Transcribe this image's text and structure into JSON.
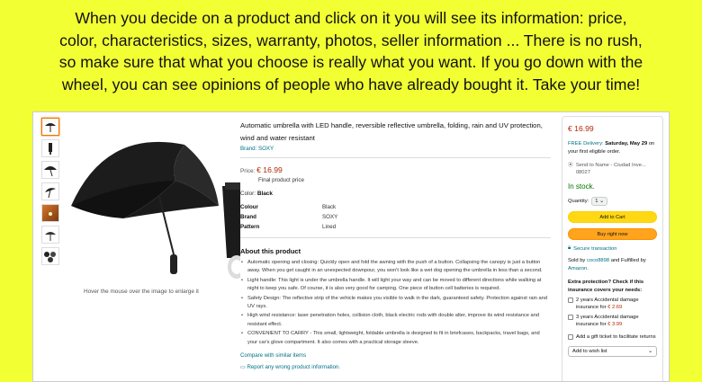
{
  "banner": {
    "lines": [
      "When you decide on a product and click on it you will see its information: price,",
      "color, characteristics, sizes, warranty, photos, seller information ... There is no rush,",
      "so make sure that what you choose is really what you want. If you go down with the",
      "wheel, you can see opinions of people who have already bought it. Take your time!"
    ]
  },
  "gallery": {
    "hover_hint": "Hover the mouse over the image to enlarge it"
  },
  "product": {
    "title": "Automatic umbrella with LED handle, reversible reflective umbrella, folding, rain and UV protection, wind and water resistant",
    "brand_link": "Brand: SOXY",
    "price_label": "Price:",
    "price_value": "€ 16.99",
    "final_price": "Final product price",
    "color_label": "Color:",
    "color_value": "Black",
    "specs": [
      {
        "k": "Colour",
        "v": "Black"
      },
      {
        "k": "Brand",
        "v": "SOXY"
      },
      {
        "k": "Pattern",
        "v": "Lined"
      }
    ],
    "about_heading": "About this product",
    "bullets": [
      "Automatic opening and closing: Quickly open and fold the awning with the push of a button. Collapsing the canopy is just a button away. When you get caught in an unexpected downpour, you won't look like a wet dog opening the umbrella in less than a second.",
      "Light handle: This light is under the umbrella handle. It will light your way and can be moved to different directions while walking at night to keep you safe. Of course, it is also very good for camping. One piece of button cell batteries is required.",
      "Safety Design: The reflective strip of the vehicle makes you visible to walk in the dark, guaranteed safety. Protection against rain and UV rays.",
      "High wind resistance: laser penetration holes, collision cloth, black electric rods with double alter, improve its wind resistance and resistant effect.",
      "CONVENIENT TO CARRY - This small, lightweight, foldable umbrella is designed to fit in briefcases, backpacks, travel bags, and your car's glove compartment. It also comes with a practical storage sleeve."
    ],
    "compare_link": "Compare with similar items",
    "report_link": "Report any wrong product information."
  },
  "buybox": {
    "price": "€ 16.99",
    "delivery_prefix": "FREE Delivery:",
    "delivery_date": "Saturday, May 29",
    "delivery_suffix": "on your first eligible order.",
    "send_to": "Send to Name - Ciudad Inve... 08027",
    "stock": "In stock.",
    "qty_label": "Quantity:",
    "qty_value": "1",
    "add_to_cart": "Add to Cart",
    "buy_now": "Buy right now",
    "secure": "Secure transaction",
    "sold_prefix": "Sold by",
    "seller": "coco8898",
    "sold_middle": "and Fulfilled by",
    "fulfiller": "Amazon",
    "protection_heading": "Extra protection? Check if this insurance covers your needs:",
    "protection_options": [
      {
        "label": "2 years Accidental damage insurance for",
        "price": "€ 2.69"
      },
      {
        "label": "3 years Accidental damage insurance for",
        "price": "€ 3.99"
      }
    ],
    "gift": "Add a gift ticket to facilitate returns",
    "wishlist": "Add to wish list"
  },
  "colors": {
    "price_red": "#b12704",
    "link_teal": "#007185",
    "stock_green": "#007600",
    "cart_yellow": "#ffd814",
    "buy_orange": "#ffa41c",
    "page_bg": "#f2ff33"
  }
}
